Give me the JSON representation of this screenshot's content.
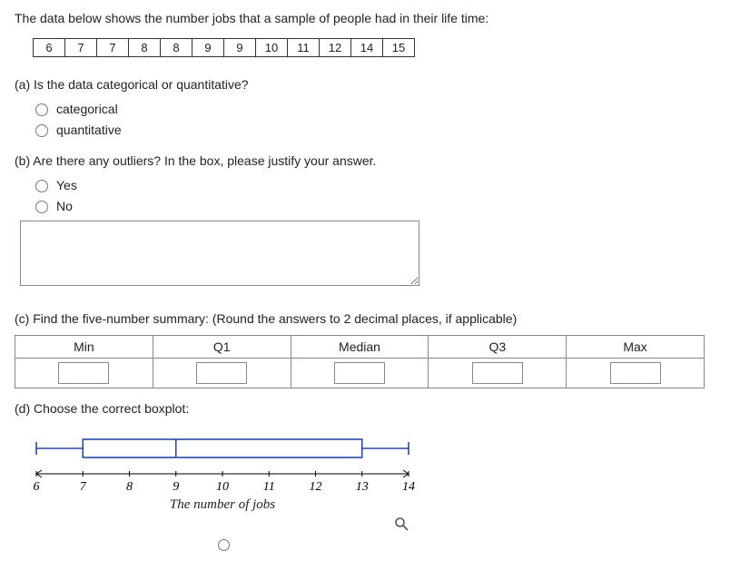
{
  "intro": "The data below shows the number jobs that a sample of people had in their life time:",
  "data_values": [
    "6",
    "7",
    "7",
    "8",
    "8",
    "9",
    "9",
    "10",
    "11",
    "12",
    "14",
    "15"
  ],
  "part_a": {
    "prompt": "(a) Is the data categorical or quantitative?",
    "options": [
      "categorical",
      "quantitative"
    ]
  },
  "part_b": {
    "prompt": "(b) Are there any outliers?  In the box, please justify your answer.",
    "options": [
      "Yes",
      "No"
    ],
    "justify_value": ""
  },
  "part_c": {
    "prompt": "(c) Find the five-number summary: (Round the answers to 2 decimal places, if applicable)",
    "headers": [
      "Min",
      "Q1",
      "Median",
      "Q3",
      "Max"
    ],
    "values": [
      "",
      "",
      "",
      "",
      ""
    ]
  },
  "part_d": {
    "prompt": "(d) Choose the correct boxplot:"
  },
  "chart_data": {
    "type": "boxplot",
    "title": "",
    "xlabel": "The number of jobs",
    "xticks": [
      6,
      7,
      8,
      9,
      10,
      11,
      12,
      13,
      14
    ],
    "xlim": [
      6,
      14
    ],
    "summary": {
      "min": 6,
      "q1": 7,
      "median": 9,
      "q3": 13,
      "max": 14
    }
  }
}
